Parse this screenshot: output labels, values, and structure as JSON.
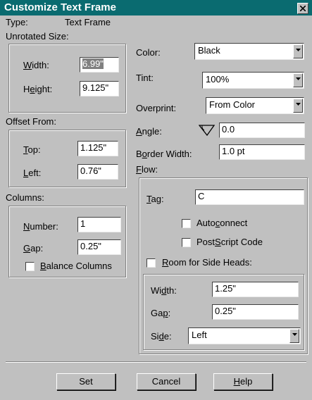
{
  "window": {
    "title": "Customize Text Frame"
  },
  "type_row": {
    "label": "Type:",
    "value": "Text Frame"
  },
  "unrotated_size": {
    "label": "Unrotated Size:",
    "width_label": "Width:",
    "width_value": "6.99\"",
    "height_label": "Height:",
    "height_value": "9.125\""
  },
  "offset_from": {
    "label": "Offset From:",
    "top_label": "Top:",
    "top_value": "1.125\"",
    "left_label": "Left:",
    "left_value": "0.76\""
  },
  "columns": {
    "label": "Columns:",
    "number_label": "Number:",
    "number_value": "1",
    "gap_label": "Gap:",
    "gap_value": "0.25\"",
    "balance_label": "Balance Columns",
    "balance_checked": false
  },
  "color": {
    "label": "Color:",
    "value": "Black"
  },
  "tint": {
    "label": "Tint:",
    "value": "100%"
  },
  "overprint": {
    "label": "Overprint:",
    "value": "From Color"
  },
  "angle": {
    "label": "Angle:",
    "value": "0.0"
  },
  "border_width": {
    "label": "Border Width:",
    "value": "1.0 pt"
  },
  "flow": {
    "label": "Flow:",
    "tag_label": "Tag:",
    "tag_value": "C",
    "autoconnect_label": "Autoconnect",
    "autoconnect_checked": false,
    "postscript_label": "PostScript Code",
    "postscript_checked": false,
    "side_heads_label": "Room for Side Heads:",
    "side_heads_checked": false,
    "side_width_label": "Width:",
    "side_width_value": "1.25\"",
    "side_gap_label": "Gap:",
    "side_gap_value": "0.25\"",
    "side_label": "Side:",
    "side_value": "Left"
  },
  "buttons": {
    "set": "Set",
    "cancel": "Cancel",
    "help": "Help"
  },
  "icons": {
    "close": "close-icon",
    "dropdown": "chevron-down-icon",
    "angle": "angle-icon"
  },
  "colors": {
    "titlebar": "#0a6b70",
    "dialog": "#c0c0c0"
  }
}
